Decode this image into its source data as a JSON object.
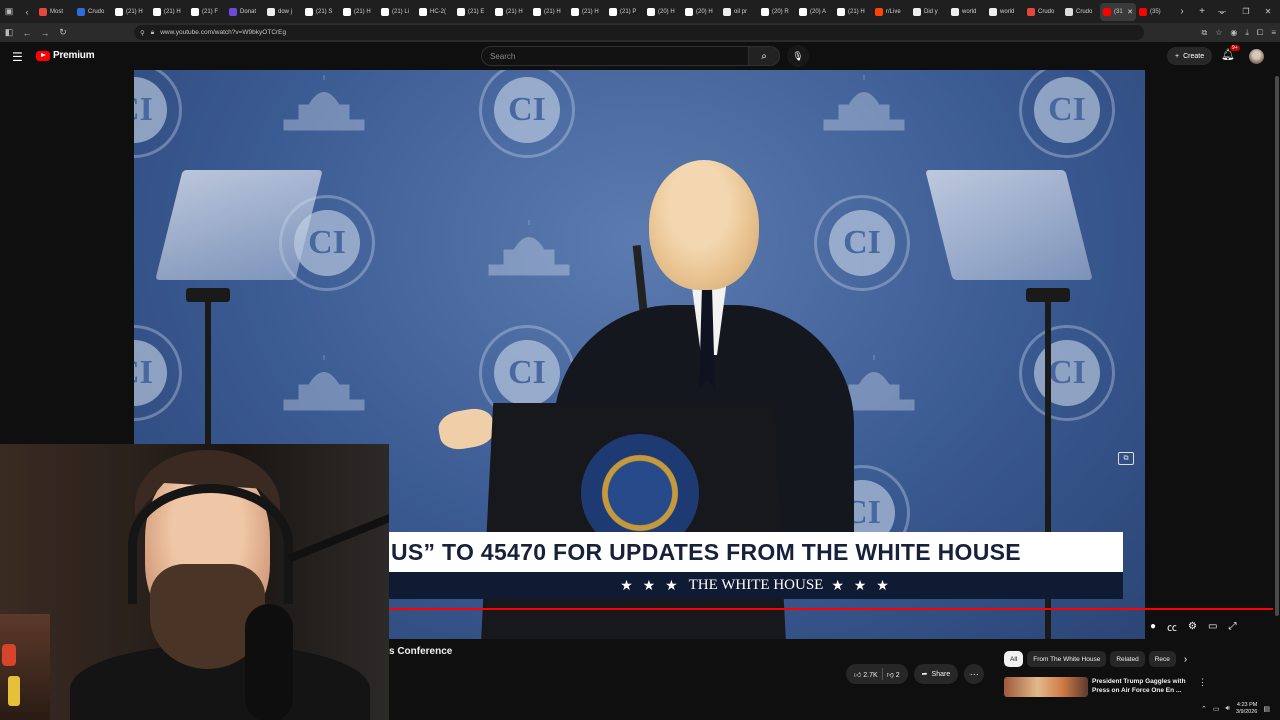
{
  "browser": {
    "tabs": [
      {
        "label": "Most",
        "color": "#e8453c"
      },
      {
        "label": "Crudo",
        "color": "#2b6cdf"
      },
      {
        "label": "(21) H",
        "color": "#ffffff"
      },
      {
        "label": "(21) H",
        "color": "#ffffff"
      },
      {
        "label": "(21) F",
        "color": "#ffffff"
      },
      {
        "label": "Donat",
        "color": "#6b4bd8"
      },
      {
        "label": "dow j",
        "color": "#eeeeee"
      },
      {
        "label": "(21) S",
        "color": "#ffffff"
      },
      {
        "label": "(21) H",
        "color": "#ffffff"
      },
      {
        "label": "(21) Li",
        "color": "#ffffff"
      },
      {
        "label": "HC-2(",
        "color": "#ffffff"
      },
      {
        "label": "(21) E",
        "color": "#ffffff"
      },
      {
        "label": "(21) H",
        "color": "#ffffff"
      },
      {
        "label": "(21) H",
        "color": "#ffffff"
      },
      {
        "label": "(21) H",
        "color": "#ffffff"
      },
      {
        "label": "(21) P",
        "color": "#ffffff"
      },
      {
        "label": "(20) H",
        "color": "#ffffff"
      },
      {
        "label": "(20) H",
        "color": "#ffffff"
      },
      {
        "label": "oil pr",
        "color": "#eeeeee"
      },
      {
        "label": "(20) R",
        "color": "#ffffff"
      },
      {
        "label": "(20) A",
        "color": "#ffffff"
      },
      {
        "label": "(21) H",
        "color": "#ffffff"
      },
      {
        "label": "r/Live",
        "color": "#ff4500"
      },
      {
        "label": "Did y",
        "color": "#eeeeee"
      },
      {
        "label": "world",
        "color": "#eeeeee"
      },
      {
        "label": "world",
        "color": "#eeeeee"
      },
      {
        "label": "Crudo",
        "color": "#e8453c"
      },
      {
        "label": "Crudo",
        "color": "#dddddd"
      }
    ],
    "active_tab": {
      "label": "(31",
      "color": "#ff0000"
    },
    "after_active": {
      "label": "(35)",
      "color": "#ff0000"
    },
    "url": "www.youtube.com/watch?v=W9bkyOTCrEg"
  },
  "youtube": {
    "logo_text": "Premium",
    "search_placeholder": "Search",
    "create_label": "Create",
    "notif_badge": "9+"
  },
  "video": {
    "ci_text": "CI",
    "lower_third_headline": "US” TO 45470 FOR UPDATES FROM THE WHITE HOUSE",
    "lower_third_stars_left": "★ ★ ★",
    "lower_third_brand": "THE WHITE HOUSE",
    "lower_third_stars_right": "★ ★ ★",
    "progress_fraction": 0.995
  },
  "below_video": {
    "title_fragment": "s Conference",
    "like_count": "2.7K",
    "dislike_count": "2",
    "share_label": "Share",
    "chips": [
      {
        "label": "All",
        "active": true
      },
      {
        "label": "From The White House",
        "active": false
      },
      {
        "label": "Related",
        "active": false
      },
      {
        "label": "Rece",
        "active": false
      }
    ],
    "rec_title": "President Trump Gaggles with Press on Air Force One En ..."
  },
  "tray": {
    "time": "4:23 PM",
    "date": "3/9/2026"
  }
}
